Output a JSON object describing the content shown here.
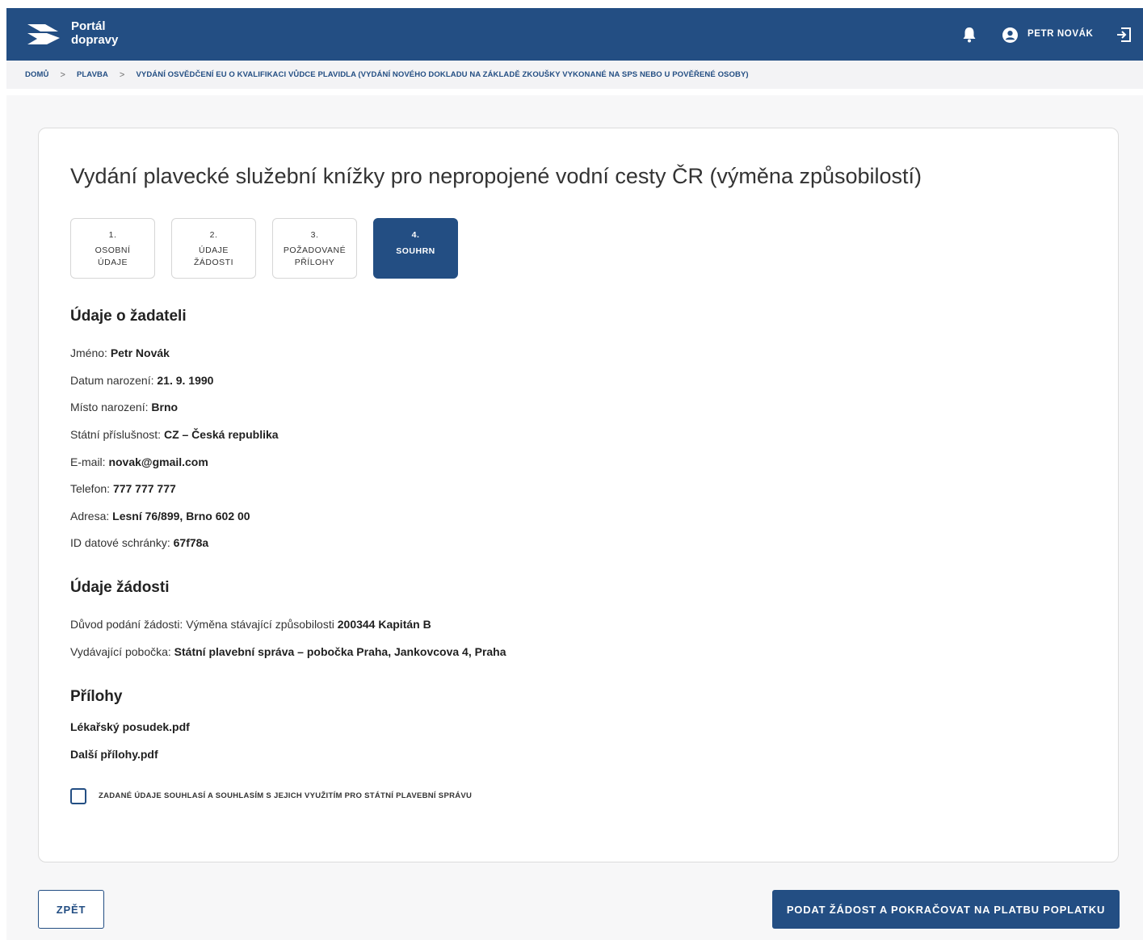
{
  "header": {
    "logo_line1": "Portál",
    "logo_line2": "dopravy",
    "user_name": "PETR NOVÁK"
  },
  "breadcrumb": [
    "DOMŮ",
    "PLAVBA",
    "VYDÁNÍ OSVĚDČENÍ EU O KVALIFIKACI VŮDCE PLAVIDLA (VYDÁNÍ NOVÉHO DOKLADU NA ZÁKLADĚ ZKOUŠKY VYKONANÉ NA SPS NEBO U POVĚŘENÉ OSOBY)"
  ],
  "page_title": "Vydání plavecké služební knížky pro nepropojené vodní cesty ČR (výměna způsobilostí)",
  "steps": [
    {
      "num": "1.",
      "label": "OSOBNÍ\nÚDAJE"
    },
    {
      "num": "2.",
      "label": "ÚDAJE\nŽÁDOSTI"
    },
    {
      "num": "3.",
      "label": "POŽADOVANÉ\nPŘÍLOHY"
    },
    {
      "num": "4.",
      "label": "SOUHRN"
    }
  ],
  "applicant": {
    "heading": "Údaje o žadateli",
    "name_label": "Jméno: ",
    "name": "Petr Novák",
    "dob_label": "Datum narození: ",
    "dob": "21. 9. 1990",
    "pob_label": "Místo narození: ",
    "pob": "Brno",
    "nationality_label": "Státní příslušnost: ",
    "nationality": "CZ – Česká republika",
    "email_label": "E-mail: ",
    "email": "novak@gmail.com",
    "phone_label": "Telefon: ",
    "phone": "777 777 777",
    "address_label": "Adresa: ",
    "address": "Lesní 76/899, Brno 602 00",
    "databox_label": "ID datové schránky: ",
    "databox": "67f78a"
  },
  "request": {
    "heading": "Údaje žádosti",
    "reason_label": "Důvod podání žádosti: Výměna stávající způsobilosti ",
    "reason": "200344 Kapitán B",
    "branch_label": "Vydávající pobočka: ",
    "branch": "Státní plavební správa – pobočka Praha, Jankovcova 4, Praha"
  },
  "attachments": {
    "heading": "Přílohy",
    "files": [
      "Lékařský posudek.pdf",
      "Další přílohy.pdf"
    ]
  },
  "consent_label": "ZADANÉ ÚDAJE SOUHLASÍ A SOUHLASÍM S JEJICH VYUŽITÍM PRO STÁTNÍ PLAVEBNÍ SPRÁVU",
  "buttons": {
    "back": "ZPĚT",
    "submit": "PODAT ŽÁDOST A POKRAČOVAT NA PLATBU POPLATKU"
  }
}
